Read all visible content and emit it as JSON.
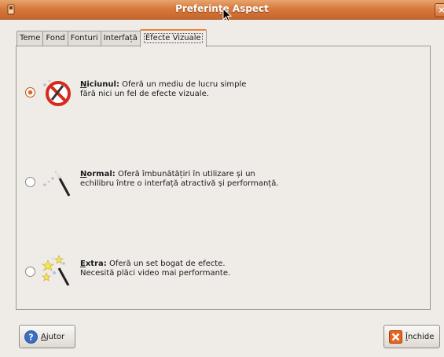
{
  "window": {
    "title": "Preferințe Aspect",
    "close_glyph": "×",
    "icon": "window-menu-icon"
  },
  "tabs": [
    {
      "label": "Teme"
    },
    {
      "label": "Fond"
    },
    {
      "label": "Fonturi"
    },
    {
      "label": "Interfață"
    },
    {
      "label": "Efecte Vizuale",
      "active": true
    }
  ],
  "options": [
    {
      "name_mn": "N",
      "name_rest": "iciunul:",
      "line1": "Oferă un mediu de lucru simple",
      "line2": "fără nici un fel de efecte vizuale.",
      "selected": true,
      "icon": "no-effects-icon"
    },
    {
      "name_mn": "N",
      "name_rest": "ormal:",
      "line1": "Oferă îmbunătățiri în utilizare și un",
      "line2": "echilibru între o interfață atractivă și performanță.",
      "selected": false,
      "icon": "magic-wand-icon"
    },
    {
      "name_mn": "E",
      "name_rest": "xtra:",
      "line1": "Oferă un set bogat de efecte.",
      "line2": "Necesită plăci video mai performante.",
      "selected": false,
      "icon": "magic-wand-sparkles-icon"
    }
  ],
  "buttons": {
    "help": {
      "mn": "A",
      "rest": "jutor",
      "icon": "help-icon"
    },
    "close": {
      "mn": "Î",
      "rest": "nchide",
      "icon": "close-icon"
    }
  },
  "colors": {
    "accent": "#d77a3d",
    "window_bg": "#efebe7"
  }
}
